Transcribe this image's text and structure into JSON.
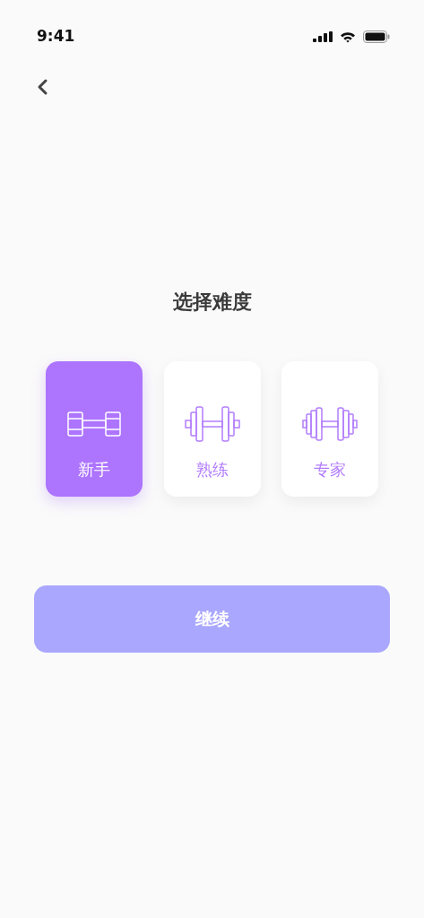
{
  "status_bar": {
    "time": "9:41"
  },
  "title": "选择难度",
  "levels": [
    {
      "label": "新手",
      "kind": "small",
      "selected": true
    },
    {
      "label": "熟练",
      "kind": "medium",
      "selected": false
    },
    {
      "label": "专家",
      "kind": "large",
      "selected": false
    }
  ],
  "continue_button": {
    "label": "继续"
  }
}
